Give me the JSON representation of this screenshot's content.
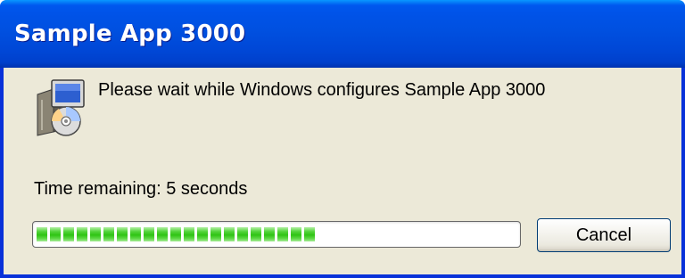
{
  "window": {
    "title": "Sample App 3000"
  },
  "content": {
    "message": "Please wait while Windows configures Sample App 3000",
    "time_remaining_label": "Time remaining: 5 seconds",
    "progress": {
      "percent": 59,
      "filled_chunks": 21
    },
    "cancel_label": "Cancel",
    "icon": "installer-disc-icon"
  },
  "colors": {
    "titlebar": "#0054e3",
    "client_bg": "#ece9d8",
    "progress_green": "#2fc414",
    "button_border": "#003c74"
  }
}
